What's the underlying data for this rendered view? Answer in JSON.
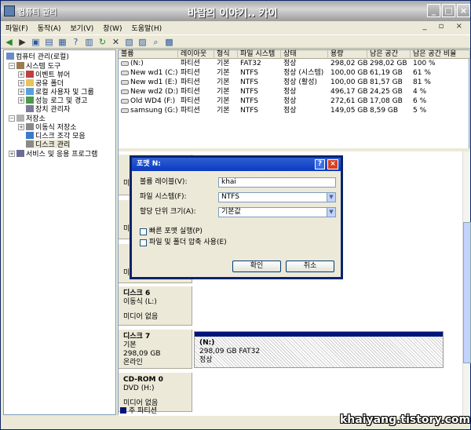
{
  "window": {
    "title": "컴퓨터 관리",
    "blog_title": "바람의 이야기.. 카이",
    "min": "_",
    "max": "□",
    "close": "×"
  },
  "menu": [
    "파일(F)",
    "동작(A)",
    "보기(V)",
    "창(W)",
    "도움말(H)"
  ],
  "menu_doc_controls": "_ ▫ ×",
  "tree": {
    "root": "컴퓨터 관리(로컬)",
    "system_tools": "시스템 도구",
    "event_viewer": "이벤트 뷰어",
    "shared_folders": "공유 폴더",
    "local_users": "로컬 사용자 및 그룹",
    "perf_logs": "성능 로그 및 경고",
    "device_mgr": "장치 관리자",
    "storage": "저장소",
    "removable": "이동식 저장소",
    "defrag": "디스크 조각 모음",
    "disk_mgmt": "디스크 관리",
    "services": "서비스 및 응용 프로그램"
  },
  "columns": [
    "볼륨",
    "레이아웃",
    "형식",
    "파일 시스템",
    "상태",
    "용량",
    "남은 공간",
    "남은 공간 비율"
  ],
  "volumes": [
    {
      "name": "(N:)",
      "layout": "파티션",
      "type": "기본",
      "fs": "FAT32",
      "status": "정상",
      "cap": "298,02 GB",
      "free": "298,02 GB",
      "pct": "100 %"
    },
    {
      "name": "New wd1 (C:)",
      "layout": "파티션",
      "type": "기본",
      "fs": "NTFS",
      "status": "정상 (시스템)",
      "cap": "100,00 GB",
      "free": "61,19 GB",
      "pct": "61 %"
    },
    {
      "name": "New wd1 (E:)",
      "layout": "파티션",
      "type": "기본",
      "fs": "NTFS",
      "status": "정상 (활성)",
      "cap": "100,00 GB",
      "free": "81,57 GB",
      "pct": "81 %"
    },
    {
      "name": "New wd2 (D:)",
      "layout": "파티션",
      "type": "기본",
      "fs": "NTFS",
      "status": "정상",
      "cap": "496,17 GB",
      "free": "24,25 GB",
      "pct": "4 %"
    },
    {
      "name": "Old WD4 (F:)",
      "layout": "파티션",
      "type": "기본",
      "fs": "NTFS",
      "status": "정상",
      "cap": "272,61 GB",
      "free": "17,08 GB",
      "pct": "6 %"
    },
    {
      "name": "samsung (G:)",
      "layout": "파티션",
      "type": "기본",
      "fs": "NTFS",
      "status": "정상",
      "cap": "149,05 GB",
      "free": "8,59 GB",
      "pct": "5 %"
    }
  ],
  "lower": {
    "frag_a": "미",
    "frag_b": "미",
    "frag_c": "미",
    "disk6": {
      "name": "디스크 6",
      "type": "이동식 (L:)",
      "media": "미디어 없음"
    },
    "disk7": {
      "name": "디스크 7",
      "type": "기본",
      "size": "298,09 GB",
      "state": "온라인",
      "part_label": "(N:)",
      "part_info": "298,09 GB FAT32",
      "part_status": "정상"
    },
    "cdrom": {
      "name": "CD-ROM 0",
      "type": "DVD (H:)",
      "media": "미디어 없음"
    },
    "legend": "주 파티션"
  },
  "dialog": {
    "title": "포맷 N:",
    "help": "?",
    "close": "×",
    "label_volume": "볼륨 레이블(V):",
    "volume_value": "khai",
    "label_fs": "파일 시스템(F):",
    "fs_value": "NTFS",
    "label_unit": "할당 단위 크기(A):",
    "unit_value": "기본값",
    "quick": "빠른 포맷 실행(P)",
    "compress": "파일 및 폴더 압축 사용(E)",
    "ok": "확인",
    "cancel": "취소"
  },
  "watermark": "khaiyang.tistory.com"
}
